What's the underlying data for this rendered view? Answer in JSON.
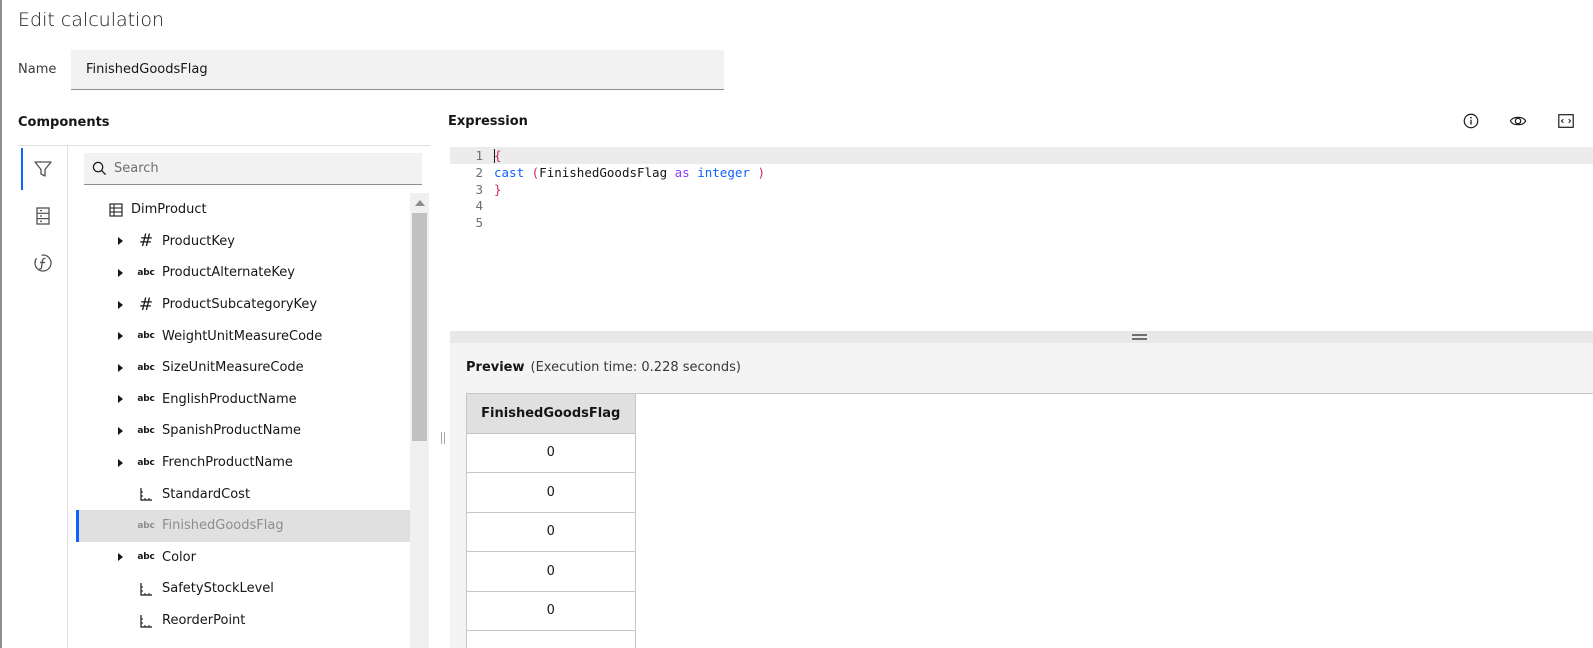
{
  "dialog": {
    "title": "Edit calculation"
  },
  "name_field": {
    "label": "Name",
    "value": "FinishedGoodsFlag"
  },
  "components": {
    "label": "Components",
    "search_placeholder": "Search",
    "rail_icons": [
      "filter-icon",
      "data-list-icon",
      "function-icon"
    ],
    "root": {
      "label": "DimProduct",
      "icon": "table-icon"
    },
    "items": [
      {
        "label": "ProductKey",
        "type": "#",
        "expandable": true
      },
      {
        "label": "ProductAlternateKey",
        "type": "abc",
        "expandable": true
      },
      {
        "label": "ProductSubcategoryKey",
        "type": "#",
        "expandable": true
      },
      {
        "label": "WeightUnitMeasureCode",
        "type": "abc",
        "expandable": true
      },
      {
        "label": "SizeUnitMeasureCode",
        "type": "abc",
        "expandable": true
      },
      {
        "label": "EnglishProductName",
        "type": "abc",
        "expandable": true
      },
      {
        "label": "SpanishProductName",
        "type": "abc",
        "expandable": true
      },
      {
        "label": "FrenchProductName",
        "type": "abc",
        "expandable": true
      },
      {
        "label": "StandardCost",
        "type": "measure",
        "expandable": false
      },
      {
        "label": "FinishedGoodsFlag",
        "type": "abc",
        "expandable": false,
        "selected": true
      },
      {
        "label": "Color",
        "type": "abc",
        "expandable": true
      },
      {
        "label": "SafetyStockLevel",
        "type": "measure",
        "expandable": false
      },
      {
        "label": "ReorderPoint",
        "type": "measure",
        "expandable": false
      }
    ]
  },
  "expression": {
    "label": "Expression",
    "toolbar_icons": [
      "information-icon",
      "view-icon",
      "code-format-icon"
    ],
    "line_numbers": [
      "1",
      "2",
      "3",
      "4",
      "5"
    ],
    "lines": {
      "l1_brace": "{",
      "l2_cast": "cast",
      "l2_open": " (",
      "l2_field": "FinishedGoodsFlag ",
      "l2_as": "as",
      "l2_sp": " ",
      "l2_integer": "integer",
      "l2_close": " )",
      "l3_brace": "}"
    }
  },
  "preview": {
    "label": "Preview",
    "execution_time": "(Execution time: 0.228 seconds)",
    "column_header": "FinishedGoodsFlag",
    "rows": [
      "0",
      "0",
      "0",
      "0",
      "0"
    ]
  }
}
